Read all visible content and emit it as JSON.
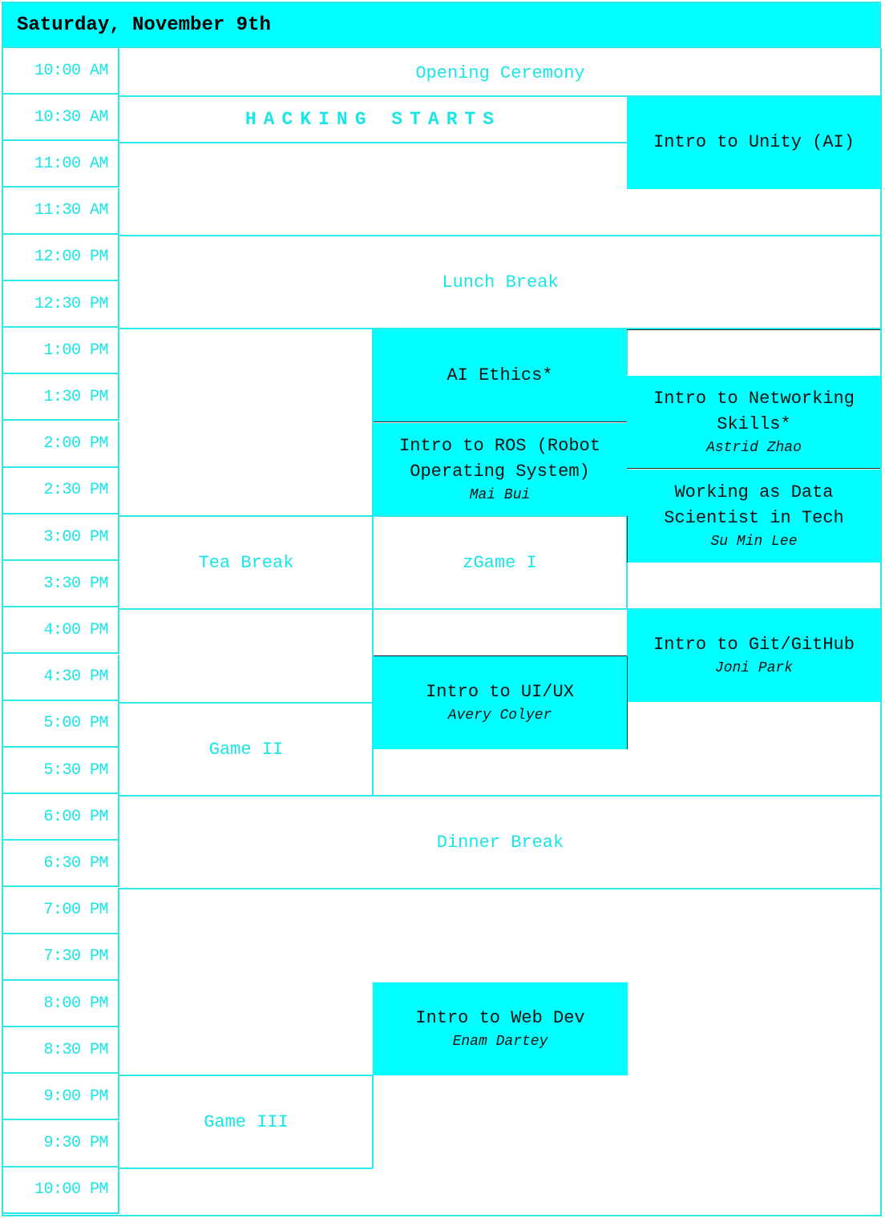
{
  "header": {
    "title": "Saturday, November 9th"
  },
  "times": [
    "10:00 AM",
    "10:30 AM",
    "11:00 AM",
    "11:30 AM",
    "12:00 PM",
    "12:30 PM",
    "1:00 PM",
    "1:30 PM",
    "2:00 PM",
    "2:30 PM",
    "3:00 PM",
    "3:30 PM",
    "4:00 PM",
    "4:30 PM",
    "5:00 PM",
    "5:30 PM",
    "6:00 PM",
    "6:30 PM",
    "7:00 PM",
    "7:30 PM",
    "8:00 PM",
    "8:30 PM",
    "9:00 PM",
    "9:30 PM",
    "10:00 PM"
  ],
  "events": {
    "opening": {
      "title": "Opening Ceremony"
    },
    "hacking": {
      "title": "HACKING STARTS"
    },
    "unity": {
      "title": "Intro to Unity (AI)"
    },
    "lunch": {
      "title": "Lunch Break"
    },
    "ethics": {
      "title": "AI Ethics*"
    },
    "networking": {
      "title": "Intro to Networking Skills*",
      "speaker": "Astrid Zhao"
    },
    "ros": {
      "title": "Intro to ROS (Robot Operating System)",
      "speaker": "Mai Bui"
    },
    "datasci": {
      "title": "Working as Data Scientist in Tech",
      "speaker": "Su Min Lee"
    },
    "tea": {
      "title": "Tea Break"
    },
    "game1": {
      "title": "zGame I"
    },
    "git": {
      "title": "Intro to Git/GitHub",
      "speaker": "Joni Park"
    },
    "uiux": {
      "title": "Intro to UI/UX",
      "speaker": "Avery Colyer"
    },
    "game2": {
      "title": "Game II"
    },
    "dinner": {
      "title": "Dinner Break"
    },
    "webdev": {
      "title": "Intro to Web Dev",
      "speaker": "Enam Dartey"
    },
    "game3": {
      "title": "Game III"
    }
  },
  "colors": {
    "accent": "#00ffff",
    "line": "#2ee8e8",
    "text": "#19e6e6"
  }
}
